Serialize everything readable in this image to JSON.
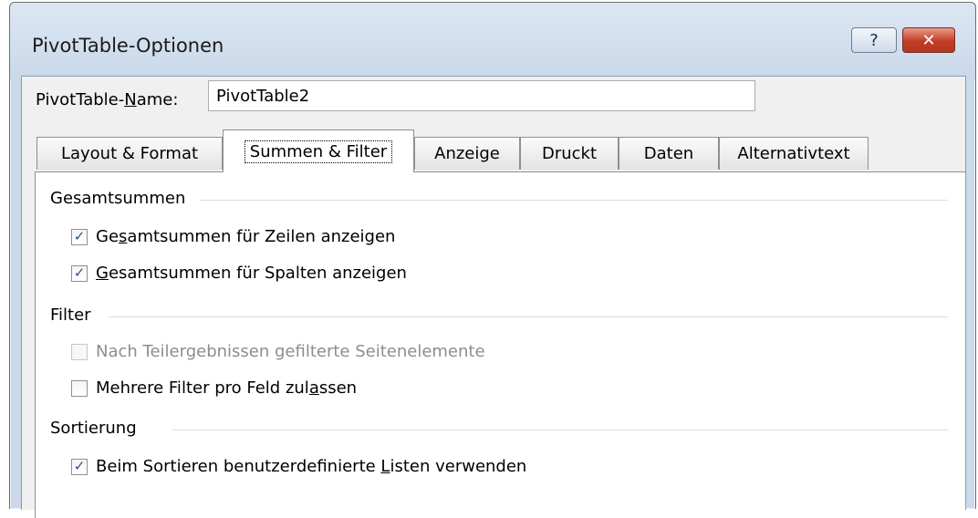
{
  "window": {
    "title": "PivotTable-Optionen",
    "help_label": "?",
    "close_label": "✕"
  },
  "name_field": {
    "label_prefix": "PivotTable-",
    "label_accel": "N",
    "label_suffix": "ame:",
    "value": "PivotTable2"
  },
  "tabs": [
    {
      "label": "Layout & Format",
      "active": false
    },
    {
      "label": "Summen & Filter",
      "active": true
    },
    {
      "label": "Anzeige",
      "active": false
    },
    {
      "label": "Druckt",
      "active": false
    },
    {
      "label": "Daten",
      "active": false
    },
    {
      "label": "Alternativtext",
      "active": false
    }
  ],
  "groups": {
    "totals": {
      "title": "Gesamtsummen",
      "rows": {
        "label_before": "Ge",
        "label_accel": "s",
        "label_after": "amtsummen für Zeilen anzeigen",
        "checked": true
      },
      "columns": {
        "label_before": "",
        "label_accel": "G",
        "label_after": "esamtsummen für Spalten anzeigen",
        "checked": true
      }
    },
    "filter": {
      "title": "Filter",
      "subtotal_items": {
        "label": "Nach Teilergebnissen gefilterte Seitenelemente",
        "checked": false,
        "enabled": false
      },
      "multiple_filters": {
        "label_before": "Mehrere Filter pro Feld zul",
        "label_accel": "a",
        "label_after": "ssen",
        "checked": false
      }
    },
    "sorting": {
      "title": "Sortierung",
      "custom_lists": {
        "label_before": "Beim Sortieren benutzerdefinierte ",
        "label_accel": "L",
        "label_after": "isten verwenden",
        "checked": true
      }
    }
  },
  "check_glyph": "✓"
}
